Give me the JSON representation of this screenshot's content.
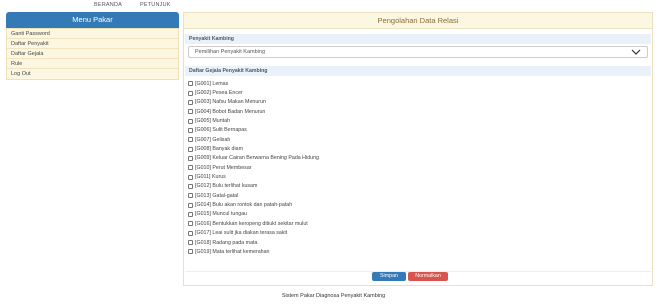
{
  "nav": {
    "home": "BERANDA",
    "help": "PETUNJUK"
  },
  "sidebar": {
    "title": "Menu Pakar",
    "items": [
      "Ganti Password",
      "Daftar Penyakit",
      "Daftar Gejala",
      "Rule",
      "Log Out"
    ]
  },
  "main": {
    "title": "Pengolahan Data Relasi",
    "disease_section_label": "Penyakit Kambing",
    "disease_select_value": "Pemilihan Penyakit Kambing",
    "symptoms_section_label": "Daftar Gejala Penyakit Kambing",
    "symptoms": [
      "[G001] Lemas",
      "[G002] Pesea Encer",
      "[G003] Nafsu Makan Menurun",
      "[G004] Bobot Badan Menurun",
      "[G005] Muntah",
      "[G006] Sulit Bernapas",
      "[G007] Gelisah",
      "[G008] Banyak diam",
      "[G009] Keluar Cairan Berwarna Bening Pada Hidung",
      "[G010] Perut Membesar",
      "[G011] Kurus",
      "[G012] Bulu terlihat kusam",
      "[G013] Gatal-gatal",
      "[G014] Bulu akan rontok dan patah-patah",
      "[G015] Muncul tungau",
      "[G016] Bentukkan keropeng ditiukt sekitar mulut",
      "[G017] Leai sulit jka diakan terasa sakit",
      "[G018] Radang pada mata",
      "[G019] Mata terlihat kemerahan"
    ],
    "save_label": "Simpan",
    "reset_label": "Normalkan"
  },
  "footer": "Sistem Pakar Diagnosa Penyakit Kambing",
  "colors": {
    "primary": "#337ab7",
    "danger": "#d9534f",
    "header_bg": "#fcf7e1",
    "sidebar_bg": "#fdf7e2"
  }
}
